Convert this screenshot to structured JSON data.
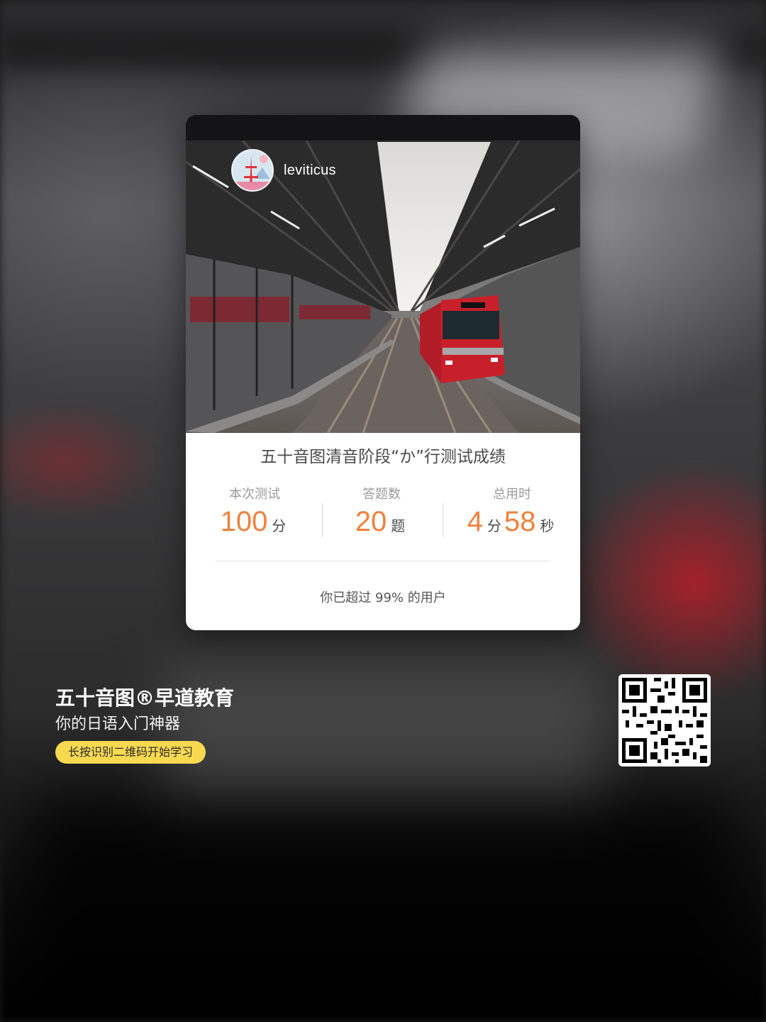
{
  "card": {
    "username": "leviticus",
    "title": "五十音图清音阶段“か”行测试成绩",
    "stats": [
      {
        "label": "本次测试",
        "value": "100",
        "unit": "分"
      },
      {
        "label": "答题数",
        "value": "20",
        "unit": "题"
      },
      {
        "label": "总用时",
        "value_min": "4",
        "unit_min": "分",
        "value_sec": "58",
        "unit_sec": "秒"
      }
    ],
    "percentile_text": "你已超过 99% 的用户"
  },
  "brand": {
    "name": "五十音图®早道教育",
    "tagline": "你的日语入门神器",
    "cta_label": "长按识别二维码开始学习"
  },
  "colors": {
    "accent": "#f0803c",
    "cta_bg": "#f8d950"
  },
  "icons": {
    "avatar": "tokyo-tower-avatar",
    "qr": "qr-code"
  }
}
